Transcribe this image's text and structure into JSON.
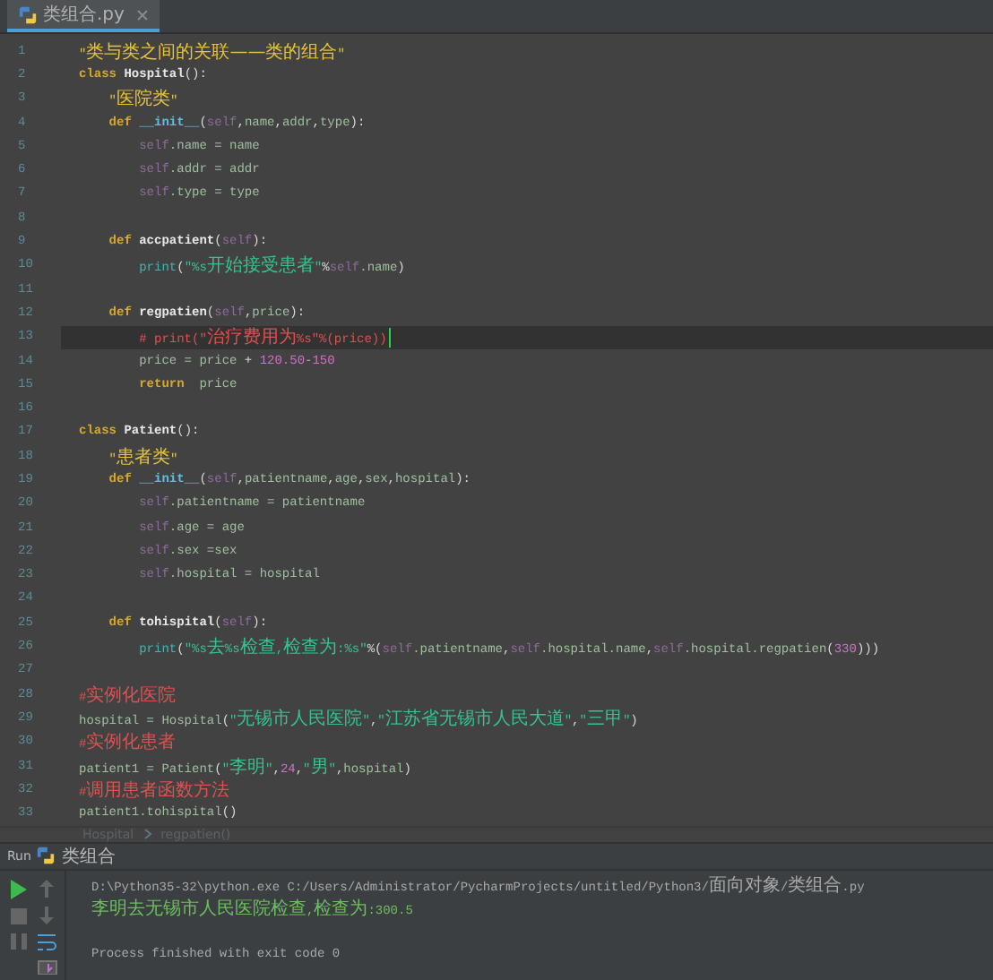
{
  "tab": {
    "filename": "类组合.py"
  },
  "lines": [
    {
      "n": "1",
      "current": false,
      "tokens": [
        {
          "kind": "doc",
          "text": "\"类与类之间的关联——类的组合\""
        }
      ]
    },
    {
      "n": "2",
      "current": false,
      "tokens": [
        {
          "kind": "kw",
          "text": "class "
        },
        {
          "kind": "cls",
          "text": "Hospital"
        },
        {
          "kind": "punct",
          "text": "():"
        }
      ]
    },
    {
      "n": "3",
      "current": false,
      "tokens": [
        {
          "kind": "doc",
          "text": "    \"医院类\""
        }
      ]
    },
    {
      "n": "4",
      "current": false,
      "tokens": [
        {
          "kind": "kw",
          "text": "    def "
        },
        {
          "kind": "fn",
          "text": "__init__"
        },
        {
          "kind": "punct",
          "text": "("
        },
        {
          "kind": "self",
          "text": "self"
        },
        {
          "kind": "punct",
          "text": ","
        },
        {
          "kind": "plain",
          "text": "name"
        },
        {
          "kind": "punct",
          "text": ","
        },
        {
          "kind": "plain",
          "text": "addr"
        },
        {
          "kind": "punct",
          "text": ","
        },
        {
          "kind": "plain",
          "text": "type"
        },
        {
          "kind": "punct",
          "text": "):"
        }
      ]
    },
    {
      "n": "5",
      "current": false,
      "tokens": [
        {
          "kind": "self",
          "text": "        self"
        },
        {
          "kind": "plain",
          "text": ".name = name"
        }
      ]
    },
    {
      "n": "6",
      "current": false,
      "tokens": [
        {
          "kind": "self",
          "text": "        self"
        },
        {
          "kind": "plain",
          "text": ".addr = addr"
        }
      ]
    },
    {
      "n": "7",
      "current": false,
      "tokens": [
        {
          "kind": "self",
          "text": "        self"
        },
        {
          "kind": "plain",
          "text": ".type = type"
        }
      ]
    },
    {
      "n": "8",
      "current": false
    },
    {
      "n": "9",
      "current": false,
      "tokens": [
        {
          "kind": "kw",
          "text": "    def "
        },
        {
          "kind": "cls",
          "text": "accpatient"
        },
        {
          "kind": "punct",
          "text": "("
        },
        {
          "kind": "self",
          "text": "self"
        },
        {
          "kind": "punct",
          "text": "):"
        }
      ]
    },
    {
      "n": "10",
      "current": false,
      "tokens": [
        {
          "kind": "builtin",
          "text": "        print"
        },
        {
          "kind": "punct",
          "text": "("
        },
        {
          "kind": "str",
          "text": "\"%s开始接受患者\""
        },
        {
          "kind": "punct",
          "text": "%"
        },
        {
          "kind": "self",
          "text": "self"
        },
        {
          "kind": "plain",
          "text": ".name"
        },
        {
          "kind": "punct",
          "text": ")"
        }
      ]
    },
    {
      "n": "11",
      "current": false
    },
    {
      "n": "12",
      "current": false,
      "tokens": [
        {
          "kind": "kw",
          "text": "    def "
        },
        {
          "kind": "cls",
          "text": "regpatien"
        },
        {
          "kind": "punct",
          "text": "("
        },
        {
          "kind": "self",
          "text": "self"
        },
        {
          "kind": "punct",
          "text": ","
        },
        {
          "kind": "plain",
          "text": "price"
        },
        {
          "kind": "punct",
          "text": "):"
        }
      ]
    },
    {
      "n": "13",
      "current": true,
      "tokens": [
        {
          "kind": "comment",
          "text": "        # print(\"治疗费用为%s\"%(price))"
        }
      ]
    },
    {
      "n": "14",
      "current": false,
      "tokens": [
        {
          "kind": "plain",
          "text": "        price = price "
        },
        {
          "kind": "punct",
          "text": "+"
        },
        {
          "kind": "num",
          "text": " 120.50"
        },
        {
          "kind": "plain",
          "text": "-"
        },
        {
          "kind": "num",
          "text": "150"
        }
      ]
    },
    {
      "n": "15",
      "current": false,
      "tokens": [
        {
          "kind": "kw",
          "text": "        return"
        },
        {
          "kind": "plain",
          "text": "  price"
        }
      ]
    },
    {
      "n": "16",
      "current": false
    },
    {
      "n": "17",
      "current": false,
      "tokens": [
        {
          "kind": "kw",
          "text": "class "
        },
        {
          "kind": "cls",
          "text": "Patient"
        },
        {
          "kind": "punct",
          "text": "():"
        }
      ]
    },
    {
      "n": "18",
      "current": false,
      "tokens": [
        {
          "kind": "doc",
          "text": "    \"患者类\""
        }
      ]
    },
    {
      "n": "19",
      "current": false,
      "tokens": [
        {
          "kind": "kw",
          "text": "    def "
        },
        {
          "kind": "fn",
          "text": "__init__"
        },
        {
          "kind": "punct",
          "text": "("
        },
        {
          "kind": "self",
          "text": "self"
        },
        {
          "kind": "punct",
          "text": ","
        },
        {
          "kind": "plain",
          "text": "patientname"
        },
        {
          "kind": "punct",
          "text": ","
        },
        {
          "kind": "plain",
          "text": "age"
        },
        {
          "kind": "punct",
          "text": ","
        },
        {
          "kind": "plain",
          "text": "sex"
        },
        {
          "kind": "punct",
          "text": ","
        },
        {
          "kind": "plain",
          "text": "hospital"
        },
        {
          "kind": "punct",
          "text": "):"
        }
      ]
    },
    {
      "n": "20",
      "current": false,
      "tokens": [
        {
          "kind": "self",
          "text": "        self"
        },
        {
          "kind": "plain",
          "text": ".patientname = patientname"
        }
      ]
    },
    {
      "n": "21",
      "current": false,
      "tokens": [
        {
          "kind": "self",
          "text": "        self"
        },
        {
          "kind": "plain",
          "text": ".age = age"
        }
      ]
    },
    {
      "n": "22",
      "current": false,
      "tokens": [
        {
          "kind": "self",
          "text": "        self"
        },
        {
          "kind": "plain",
          "text": ".sex =sex"
        }
      ]
    },
    {
      "n": "23",
      "current": false,
      "tokens": [
        {
          "kind": "self",
          "text": "        self"
        },
        {
          "kind": "plain",
          "text": ".hospital = hospital"
        }
      ]
    },
    {
      "n": "24",
      "current": false
    },
    {
      "n": "25",
      "current": false,
      "tokens": [
        {
          "kind": "kw",
          "text": "    def "
        },
        {
          "kind": "cls",
          "text": "tohispital"
        },
        {
          "kind": "punct",
          "text": "("
        },
        {
          "kind": "self",
          "text": "self"
        },
        {
          "kind": "punct",
          "text": "):"
        }
      ]
    },
    {
      "n": "26",
      "current": false,
      "tokens": [
        {
          "kind": "builtin",
          "text": "        print"
        },
        {
          "kind": "punct",
          "text": "("
        },
        {
          "kind": "str",
          "text": "\"%s去%s检查,检查为:%s\""
        },
        {
          "kind": "punct",
          "text": "%("
        },
        {
          "kind": "self",
          "text": "self"
        },
        {
          "kind": "plain",
          "text": ".patientname"
        },
        {
          "kind": "punct",
          "text": ","
        },
        {
          "kind": "self",
          "text": "self"
        },
        {
          "kind": "plain",
          "text": ".hospital.name"
        },
        {
          "kind": "punct",
          "text": ","
        },
        {
          "kind": "self",
          "text": "self"
        },
        {
          "kind": "plain",
          "text": ".hospital.regpatien"
        },
        {
          "kind": "punct",
          "text": "("
        },
        {
          "kind": "num",
          "text": "330"
        },
        {
          "kind": "punct",
          "text": ")))"
        }
      ]
    },
    {
      "n": "27",
      "current": false
    },
    {
      "n": "28",
      "current": false,
      "tokens": [
        {
          "kind": "comment",
          "text": "#实例化医院"
        }
      ]
    },
    {
      "n": "29",
      "current": false,
      "tokens": [
        {
          "kind": "plain",
          "text": "hospital = Hospital"
        },
        {
          "kind": "punct",
          "text": "("
        },
        {
          "kind": "str",
          "text": "\"无锡市人民医院\""
        },
        {
          "kind": "punct",
          "text": ","
        },
        {
          "kind": "str",
          "text": "\"江苏省无锡市人民大道\""
        },
        {
          "kind": "punct",
          "text": ","
        },
        {
          "kind": "str",
          "text": "\"三甲\""
        },
        {
          "kind": "punct",
          "text": ")"
        }
      ]
    },
    {
      "n": "30",
      "current": false,
      "tokens": [
        {
          "kind": "comment",
          "text": "#实例化患者"
        }
      ]
    },
    {
      "n": "31",
      "current": false,
      "tokens": [
        {
          "kind": "plain",
          "text": "patient1 = Patient"
        },
        {
          "kind": "punct",
          "text": "("
        },
        {
          "kind": "str",
          "text": "\"李明\""
        },
        {
          "kind": "punct",
          "text": ","
        },
        {
          "kind": "num",
          "text": "24"
        },
        {
          "kind": "punct",
          "text": ","
        },
        {
          "kind": "str",
          "text": "\"男\""
        },
        {
          "kind": "punct",
          "text": ","
        },
        {
          "kind": "plain",
          "text": "hospital"
        },
        {
          "kind": "punct",
          "text": ")"
        }
      ]
    },
    {
      "n": "32",
      "current": false,
      "tokens": [
        {
          "kind": "comment",
          "text": "#调用患者函数方法"
        }
      ]
    },
    {
      "n": "33",
      "current": false,
      "tokens": [
        {
          "kind": "plain",
          "text": "patient1.tohispital"
        },
        {
          "kind": "punct",
          "text": "()"
        }
      ]
    }
  ],
  "breadcrumb": [
    "Hospital",
    "regpatien()"
  ],
  "run_panel": {
    "label": "Run",
    "config": "类组合",
    "console": [
      {
        "kind": "command",
        "text": "D:\\Python35-32\\python.exe C:/Users/Administrator/PycharmProjects/untitled/Python3/面向对象/类组合.py"
      },
      {
        "kind": "output",
        "text": "李明去无锡市人民医院检查,检查为:300.5"
      },
      {
        "kind": "blank"
      },
      {
        "kind": "info",
        "text": "Process finished with exit code 0"
      }
    ]
  }
}
